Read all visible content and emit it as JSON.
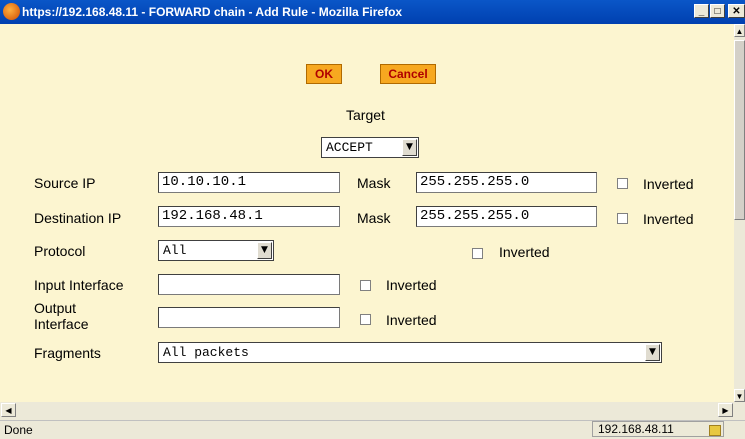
{
  "window": {
    "title": "https://192.168.48.11 - FORWARD chain - Add Rule - Mozilla Firefox"
  },
  "form": {
    "ok_label": "OK",
    "cancel_label": "Cancel",
    "target_label": "Target",
    "target_value": "ACCEPT",
    "source_ip": {
      "label": "Source IP",
      "value": "10.10.10.1",
      "mask_label": "Mask",
      "mask_value": "255.255.255.0",
      "inverted_label": "Inverted"
    },
    "destination_ip": {
      "label": "Destination IP",
      "value": "192.168.48.1",
      "mask_label": "Mask",
      "mask_value": "255.255.255.0",
      "inverted_label": "Inverted"
    },
    "protocol": {
      "label": "Protocol",
      "value": "All",
      "inverted_label": "Inverted"
    },
    "input_interface": {
      "label": "Input Interface",
      "value": "",
      "inverted_label": "Inverted"
    },
    "output_interface": {
      "label_line1": "Output",
      "label_line2": "Interface",
      "value": "",
      "inverted_label": "Inverted"
    },
    "fragments": {
      "label": "Fragments",
      "value": "All packets"
    }
  },
  "status": {
    "left": "Done",
    "host": "192.168.48.11"
  }
}
